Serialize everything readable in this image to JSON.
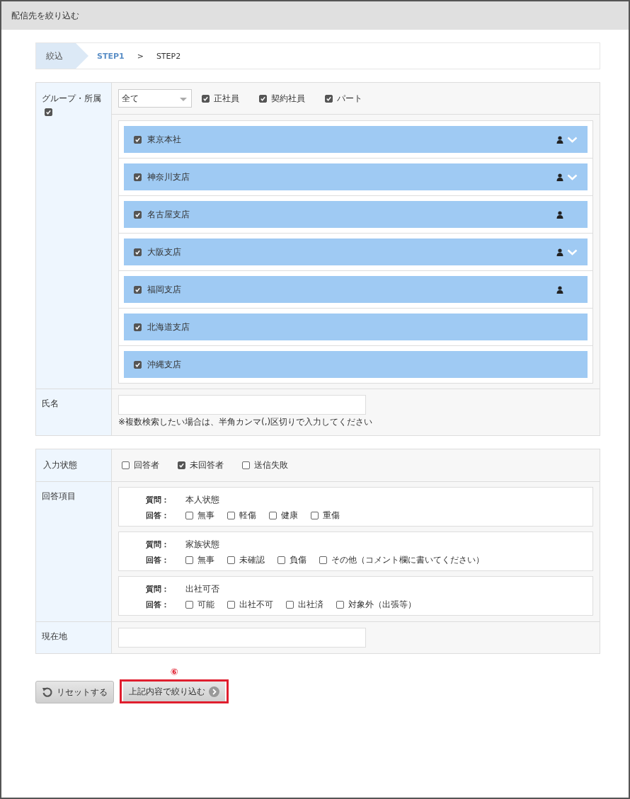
{
  "window": {
    "title": "配信先を絞り込む"
  },
  "breadcrumb": {
    "current": "絞込",
    "steps": [
      {
        "label": "STEP1",
        "selected": true
      },
      {
        "label": "STEP2",
        "selected": false
      }
    ],
    "separator": ">"
  },
  "group_filter": {
    "label": "グループ・所属",
    "checked": true,
    "select": {
      "value": "全て"
    },
    "types": [
      {
        "label": "正社員",
        "checked": true
      },
      {
        "label": "契約社員",
        "checked": true
      },
      {
        "label": "パート",
        "checked": true
      }
    ],
    "groups": [
      {
        "name": "東京本社",
        "checked": true,
        "has_members": true,
        "expandable": true
      },
      {
        "name": "神奈川支店",
        "checked": true,
        "has_members": true,
        "expandable": true
      },
      {
        "name": "名古屋支店",
        "checked": true,
        "has_members": true,
        "expandable": false
      },
      {
        "name": "大阪支店",
        "checked": true,
        "has_members": true,
        "expandable": true
      },
      {
        "name": "福岡支店",
        "checked": true,
        "has_members": true,
        "expandable": false
      },
      {
        "name": "北海道支店",
        "checked": true,
        "has_members": false,
        "expandable": false
      },
      {
        "name": "沖縄支店",
        "checked": true,
        "has_members": false,
        "expandable": false
      }
    ]
  },
  "name_filter": {
    "label": "氏名",
    "note": "※複数検索したい場合は、半角カンマ(,)区切りで入力してください"
  },
  "status_filter": {
    "label": "入力状態",
    "options": [
      {
        "label": "回答者",
        "checked": false
      },
      {
        "label": "未回答者",
        "checked": true
      },
      {
        "label": "送信失敗",
        "checked": false
      }
    ]
  },
  "answer_filter": {
    "label": "回答項目",
    "questions": [
      {
        "question_label": "質問：",
        "answer_label": "回答：",
        "question": "本人状態",
        "answers": [
          {
            "label": "無事",
            "checked": false
          },
          {
            "label": "軽傷",
            "checked": false
          },
          {
            "label": "健康",
            "checked": false
          },
          {
            "label": "重傷",
            "checked": false
          }
        ]
      },
      {
        "question_label": "質問：",
        "answer_label": "回答：",
        "question": "家族状態",
        "answers": [
          {
            "label": "無事",
            "checked": false
          },
          {
            "label": "未確認",
            "checked": false
          },
          {
            "label": "負傷",
            "checked": false
          },
          {
            "label": "その他（コメント欄に書いてください）",
            "checked": false
          }
        ]
      },
      {
        "question_label": "質問：",
        "answer_label": "回答：",
        "question": "出社可否",
        "answers": [
          {
            "label": "可能",
            "checked": false
          },
          {
            "label": "出社不可",
            "checked": false
          },
          {
            "label": "出社済",
            "checked": false
          },
          {
            "label": "対象外（出張等）",
            "checked": false
          }
        ]
      }
    ]
  },
  "location_filter": {
    "label": "現在地"
  },
  "buttons": {
    "reset": "リセットする",
    "apply": "上記内容で絞り込む"
  },
  "annotation": {
    "number": "⑥"
  }
}
